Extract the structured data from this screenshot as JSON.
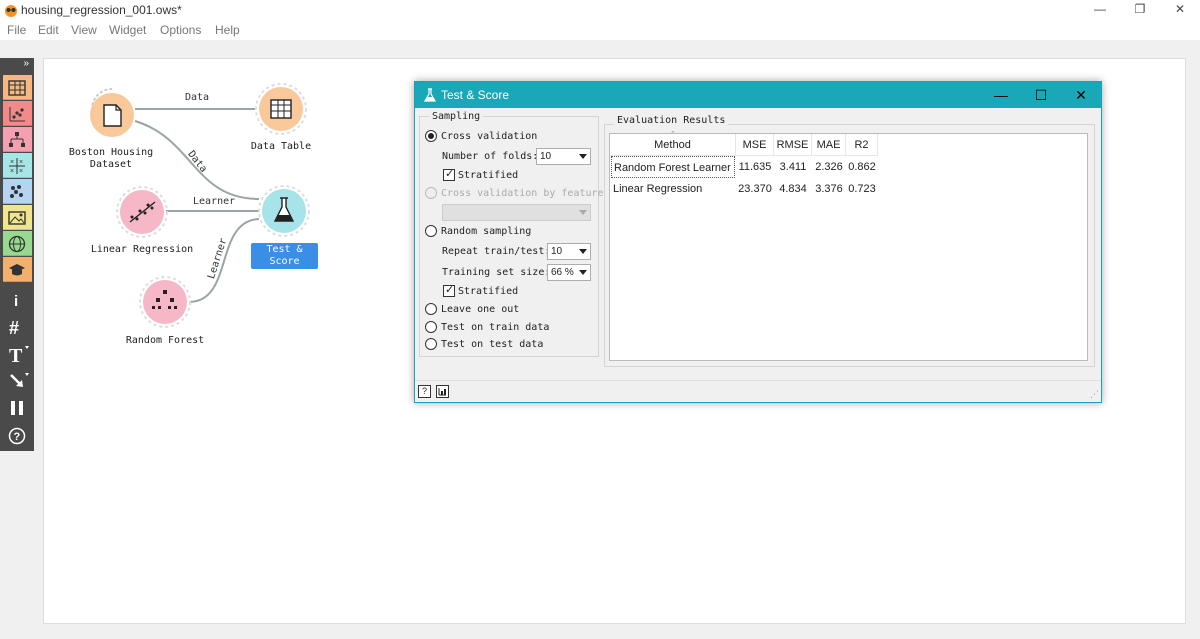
{
  "window": {
    "title": "housing_regression_001.ows*",
    "controls": [
      "minimize",
      "restore",
      "close"
    ]
  },
  "menu": [
    "File",
    "Edit",
    "View",
    "Widget",
    "Options",
    "Help"
  ],
  "toolbar": {
    "collapse_label": "»",
    "categories": [
      {
        "name": "data",
        "color": "#f5b880",
        "icon": "table-icon"
      },
      {
        "name": "visualize",
        "color": "#f28a8a",
        "icon": "scatter-icon"
      },
      {
        "name": "model",
        "color": "#f4a0b0",
        "icon": "tree-icon"
      },
      {
        "name": "evaluate",
        "color": "#a6e6e6",
        "icon": "grid-x-icon"
      },
      {
        "name": "unsupervised",
        "color": "#b4d4ef",
        "icon": "cluster-icon"
      },
      {
        "name": "image-analytics",
        "color": "#f0e58f",
        "icon": "image-icon"
      },
      {
        "name": "geo",
        "color": "#96d98f",
        "icon": "globe-icon"
      },
      {
        "name": "educational",
        "color": "#f2b06c",
        "icon": "graduation-cap-icon"
      }
    ],
    "tools": [
      "info-icon",
      "grid-hash-icon",
      "text-icon",
      "arrow-icon",
      "pause-icon",
      "help-icon"
    ]
  },
  "canvas": {
    "nodes": [
      {
        "id": "boston",
        "label": "Boston Housing\nDataset",
        "label_lines": [
          "Boston Housing",
          "Dataset"
        ],
        "color": "#f9c99b"
      },
      {
        "id": "datatable",
        "label": "Data Table",
        "color": "#f9c99b"
      },
      {
        "id": "linreg",
        "label": "Linear Regression",
        "color": "#f6b8c6"
      },
      {
        "id": "testscore",
        "label": "Test & Score",
        "color": "#a7e4ea",
        "selected": true
      },
      {
        "id": "rforest",
        "label": "Random Forest",
        "color": "#f6b8c6"
      }
    ],
    "links": [
      {
        "from": "boston",
        "to": "datatable",
        "label": "Data"
      },
      {
        "from": "boston",
        "to": "testscore",
        "label": "Data"
      },
      {
        "from": "linreg",
        "to": "testscore",
        "label": "Learner"
      },
      {
        "from": "rforest",
        "to": "testscore",
        "label": "Learner"
      }
    ]
  },
  "test_score": {
    "title": "Test & Score",
    "sampling": {
      "group_title": "Sampling",
      "cross_validation": "Cross validation",
      "folds_label": "Number of folds:",
      "folds_value": "10",
      "stratified_1": "Stratified",
      "cv_by_feature": "Cross validation by feature",
      "random_sampling": "Random sampling",
      "repeat_label": "Repeat train/test:",
      "repeat_value": "10",
      "train_size_label": "Training set size:",
      "train_size_value": "66 %",
      "stratified_2": "Stratified",
      "leave_one_out": "Leave one out",
      "test_on_train": "Test on train data",
      "test_on_test": "Test on test data",
      "selected": "Cross validation"
    },
    "results": {
      "group_title": "Evaluation Results",
      "columns": [
        "Method",
        "MSE",
        "RMSE",
        "MAE",
        "R2"
      ],
      "rows": [
        [
          "Random Forest Learner",
          "11.635",
          "3.411",
          "2.326",
          "0.862"
        ],
        [
          "Linear Regression",
          "23.370",
          "4.834",
          "3.376",
          "0.723"
        ]
      ]
    },
    "status_buttons": [
      "?",
      "report-icon"
    ]
  }
}
